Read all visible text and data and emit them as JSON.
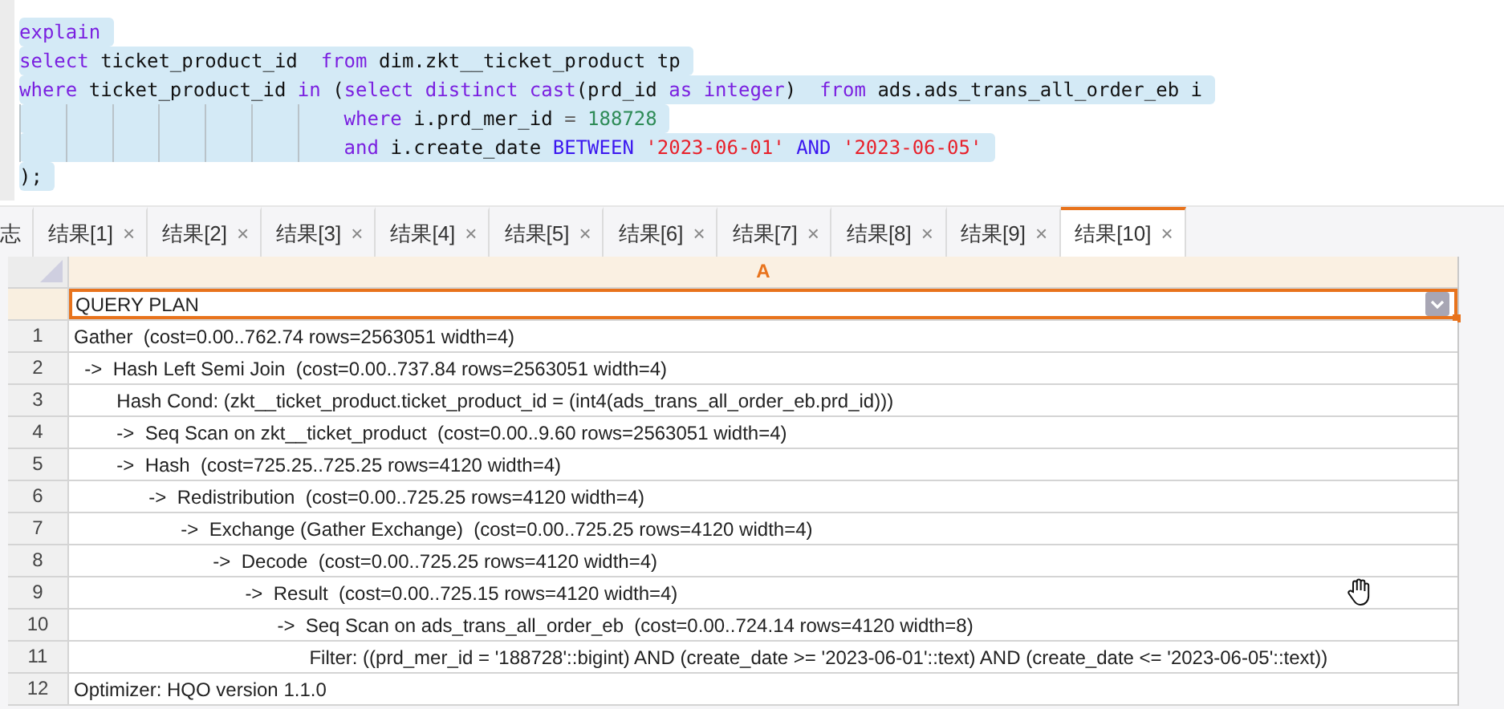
{
  "editor": {
    "lines": [
      {
        "selected": true,
        "guides": false,
        "tokens": [
          {
            "kind": "keyword",
            "text": "explain"
          }
        ]
      },
      {
        "selected": true,
        "guides": false,
        "tokens": [
          {
            "kind": "keyword",
            "text": "select"
          },
          {
            "kind": "plain",
            "text": " ticket_product_id  "
          },
          {
            "kind": "keyword",
            "text": "from"
          },
          {
            "kind": "plain",
            "text": " dim.zkt__ticket_product tp"
          }
        ]
      },
      {
        "selected": true,
        "guides": false,
        "tokens": [
          {
            "kind": "keyword",
            "text": "where"
          },
          {
            "kind": "plain",
            "text": " ticket_product_id "
          },
          {
            "kind": "keyword",
            "text": "in"
          },
          {
            "kind": "plain",
            "text": " ("
          },
          {
            "kind": "keyword",
            "text": "select "
          },
          {
            "kind": "keyword",
            "text": "distinct "
          },
          {
            "kind": "keyword",
            "text": "cast"
          },
          {
            "kind": "plain",
            "text": "(prd_id "
          },
          {
            "kind": "keyword",
            "text": "as "
          },
          {
            "kind": "keyword",
            "text": "integer"
          },
          {
            "kind": "plain",
            "text": ")  "
          },
          {
            "kind": "keyword",
            "text": "from"
          },
          {
            "kind": "plain",
            "text": " ads.ads_trans_all_order_eb i"
          }
        ]
      },
      {
        "selected": true,
        "guides": true,
        "tokens": [
          {
            "kind": "keyword",
            "text": "where"
          },
          {
            "kind": "plain",
            "text": " i.prd_mer_id "
          },
          {
            "kind": "operator",
            "text": "= "
          },
          {
            "kind": "number",
            "text": "188728"
          }
        ]
      },
      {
        "selected": true,
        "guides": true,
        "tokens": [
          {
            "kind": "keyword",
            "text": "and"
          },
          {
            "kind": "plain",
            "text": " i.create_date "
          },
          {
            "kind": "keyword2",
            "text": "BETWEEN "
          },
          {
            "kind": "string",
            "text": "'2023-06-01' "
          },
          {
            "kind": "keyword2",
            "text": "AND "
          },
          {
            "kind": "string",
            "text": "'2023-06-05'"
          }
        ]
      },
      {
        "selected": true,
        "guides": false,
        "tokens": [
          {
            "kind": "plain",
            "text": ");"
          }
        ]
      }
    ]
  },
  "result_tabs": [
    {
      "label": "志",
      "closable": false,
      "selected": false
    },
    {
      "label": "结果[1]",
      "closable": true,
      "selected": false
    },
    {
      "label": "结果[2]",
      "closable": true,
      "selected": false
    },
    {
      "label": "结果[3]",
      "closable": true,
      "selected": false
    },
    {
      "label": "结果[4]",
      "closable": true,
      "selected": false
    },
    {
      "label": "结果[5]",
      "closable": true,
      "selected": false
    },
    {
      "label": "结果[6]",
      "closable": true,
      "selected": false
    },
    {
      "label": "结果[7]",
      "closable": true,
      "selected": false
    },
    {
      "label": "结果[8]",
      "closable": true,
      "selected": false
    },
    {
      "label": "结果[9]",
      "closable": true,
      "selected": false
    },
    {
      "label": "结果[10]",
      "closable": true,
      "selected": true
    }
  ],
  "close_glyph": "×",
  "grid": {
    "columns": [
      "A"
    ],
    "header_cell": {
      "text": "QUERY PLAN",
      "selected": true
    },
    "rows": [
      {
        "number": "1",
        "text": "Gather  (cost=0.00..762.74 rows=2563051 width=4)",
        "selected": false
      },
      {
        "number": "2",
        "text": "  ->  Hash Left Semi Join  (cost=0.00..737.84 rows=2563051 width=4)",
        "selected": false
      },
      {
        "number": "3",
        "text": "        Hash Cond: (zkt__ticket_product.ticket_product_id = (int4(ads_trans_all_order_eb.prd_id)))",
        "selected": false
      },
      {
        "number": "4",
        "text": "        ->  Seq Scan on zkt__ticket_product  (cost=0.00..9.60 rows=2563051 width=4)",
        "selected": false
      },
      {
        "number": "5",
        "text": "        ->  Hash  (cost=725.25..725.25 rows=4120 width=4)",
        "selected": false
      },
      {
        "number": "6",
        "text": "              ->  Redistribution  (cost=0.00..725.25 rows=4120 width=4)",
        "selected": false
      },
      {
        "number": "7",
        "text": "                    ->  Exchange (Gather Exchange)  (cost=0.00..725.25 rows=4120 width=4)",
        "selected": false
      },
      {
        "number": "8",
        "text": "                          ->  Decode  (cost=0.00..725.25 rows=4120 width=4)",
        "selected": false
      },
      {
        "number": "9",
        "text": "                                ->  Result  (cost=0.00..725.15 rows=4120 width=4)",
        "selected": false
      },
      {
        "number": "10",
        "text": "                                      ->  Seq Scan on ads_trans_all_order_eb  (cost=0.00..724.14 rows=4120 width=8)",
        "selected": false
      },
      {
        "number": "11",
        "text": "                                            Filter: ((prd_mer_id = '188728'::bigint) AND (create_date >= '2023-06-01'::text) AND (create_date <= '2023-06-05'::text))",
        "selected": false
      },
      {
        "number": "12",
        "text": "Optimizer: HQO version 1.1.0",
        "selected": false
      }
    ]
  }
}
